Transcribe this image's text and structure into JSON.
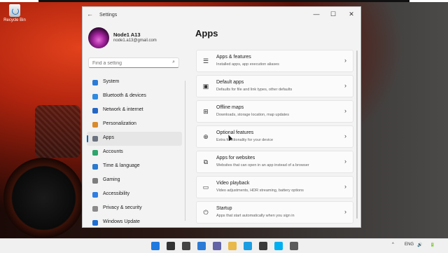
{
  "desktop": {
    "icon_label": "Recycle Bin"
  },
  "window": {
    "title": "Settings",
    "back_glyph": "←",
    "controls": {
      "minimize": "—",
      "maximize": "☐",
      "close": "✕"
    }
  },
  "profile": {
    "name": "Node1 A13",
    "email": "node1.a13@gmail.com"
  },
  "search": {
    "placeholder": "Find a setting",
    "icon": "⌕"
  },
  "nav": {
    "items": [
      {
        "label": "System",
        "icon": "system-icon",
        "color": "#2b7bd6"
      },
      {
        "label": "Bluetooth & devices",
        "icon": "bluetooth-icon",
        "color": "#2f8be0"
      },
      {
        "label": "Network & internet",
        "icon": "network-icon",
        "color": "#2566c4"
      },
      {
        "label": "Personalization",
        "icon": "brush-icon",
        "color": "#d98a2b"
      },
      {
        "label": "Apps",
        "icon": "apps-icon",
        "color": "#6b7280",
        "active": true
      },
      {
        "label": "Accounts",
        "icon": "accounts-icon",
        "color": "#2ea56c"
      },
      {
        "label": "Time & language",
        "icon": "time-icon",
        "color": "#2a7ad0"
      },
      {
        "label": "Gaming",
        "icon": "gaming-icon",
        "color": "#7d7d7d"
      },
      {
        "label": "Accessibility",
        "icon": "accessibility-icon",
        "color": "#2f7de0"
      },
      {
        "label": "Privacy & security",
        "icon": "shield-icon",
        "color": "#8a8a8a"
      },
      {
        "label": "Windows Update",
        "icon": "update-icon",
        "color": "#1f6fd1"
      }
    ]
  },
  "page": {
    "title": "Apps"
  },
  "cards": [
    {
      "title": "Apps & features",
      "desc": "Installed apps, app execution aliases",
      "icon": "☰"
    },
    {
      "title": "Default apps",
      "desc": "Defaults for file and link types, other defaults",
      "icon": "▣"
    },
    {
      "title": "Offline maps",
      "desc": "Downloads, storage location, map updates",
      "icon": "⊞"
    },
    {
      "title": "Optional features",
      "desc": "Extra functionality for your device",
      "icon": "⊕"
    },
    {
      "title": "Apps for websites",
      "desc": "Websites that can open in an app instead of a browser",
      "icon": "⧉"
    },
    {
      "title": "Video playback",
      "desc": "Video adjustments, HDR streaming, battery options",
      "icon": "▭"
    },
    {
      "title": "Startup",
      "desc": "Apps that start automatically when you sign in",
      "icon": "⏻"
    }
  ],
  "chevron": "›",
  "taskbar": {
    "icons": [
      {
        "name": "start-icon",
        "color": "#1f7ae0"
      },
      {
        "name": "search-icon",
        "color": "#333333"
      },
      {
        "name": "task-view-icon",
        "color": "#444444"
      },
      {
        "name": "widgets-icon",
        "color": "#2b7bd6"
      },
      {
        "name": "chat-icon",
        "color": "#6264a7"
      },
      {
        "name": "file-explorer-icon",
        "color": "#e8b84a"
      },
      {
        "name": "edge-icon",
        "color": "#1b9de2"
      },
      {
        "name": "store-icon",
        "color": "#3b3b3b"
      },
      {
        "name": "skype-icon",
        "color": "#00aff0"
      },
      {
        "name": "settings-icon",
        "color": "#5b5b5b"
      }
    ],
    "tray": [
      "^",
      "ENG",
      "🔊",
      "🔋"
    ]
  }
}
